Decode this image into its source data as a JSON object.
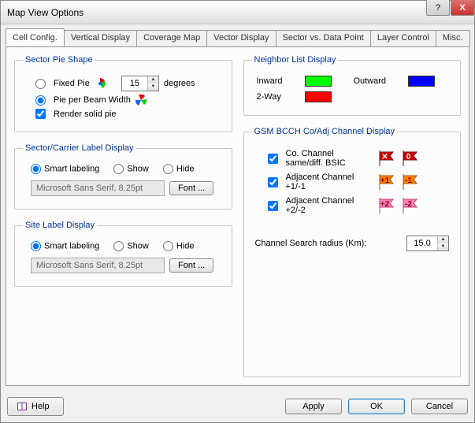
{
  "window": {
    "title": "Map View Options",
    "tb_help": "?",
    "tb_close": "X"
  },
  "tabs": [
    "Cell Config.",
    "Vertical Display",
    "Coverage Map",
    "Vector Display",
    "Sector vs. Data Point",
    "Layer Control",
    "Misc."
  ],
  "active_tab": 0,
  "sector_pie": {
    "legend": "Sector Pie Shape",
    "fixed_pie": "Fixed Pie",
    "degrees_value": "15",
    "degrees_label": "degrees",
    "pie_per_beam": "Pie per Beam Width",
    "render_solid": "Render solid pie",
    "selected": "pie_per_beam",
    "render_checked": true
  },
  "sector_label": {
    "legend": "Sector/Carrier Label Display",
    "opt_smart": "Smart labeling",
    "opt_show": "Show",
    "opt_hide": "Hide",
    "selected": "smart",
    "font_text": "Microsoft Sans Serif, 8.25pt",
    "font_btn": "Font ..."
  },
  "site_label": {
    "legend": "Site Label Display",
    "opt_smart": "Smart labeling",
    "opt_show": "Show",
    "opt_hide": "Hide",
    "selected": "smart",
    "font_text": "Microsoft Sans Serif, 8.25pt",
    "font_btn": "Font ..."
  },
  "neighbor": {
    "legend": "Neighbor List Display",
    "inward": "Inward",
    "outward": "Outward",
    "two_way": "2-Way",
    "colors": {
      "inward": "#00ff00",
      "outward": "#0000ff",
      "two_way": "#ff0000"
    }
  },
  "channel": {
    "legend": "GSM BCCH Co/Adj Channel Display",
    "co_label": "Co. Channel same/diff. BSIC",
    "adj1_label": "Adjacent Channel +1/-1",
    "adj2_label": "Adjacent Channel +2/-2",
    "co_checked": true,
    "adj1_checked": true,
    "adj2_checked": true,
    "co_flags": [
      "✕",
      "0"
    ],
    "adj1_flags": [
      "+1",
      "-1"
    ],
    "adj2_flags": [
      "+2",
      "-2"
    ],
    "co_colors": [
      "#cc0000",
      "#cc0000"
    ],
    "adj1_colors": [
      "#ff8000",
      "#ff8000"
    ],
    "adj2_colors": [
      "#ff80c0",
      "#ff80c0"
    ]
  },
  "search_radius": {
    "label": "Channel Search radius (Km):",
    "value": "15.0"
  },
  "footer": {
    "help": "Help",
    "apply": "Apply",
    "ok": "OK",
    "cancel": "Cancel"
  }
}
